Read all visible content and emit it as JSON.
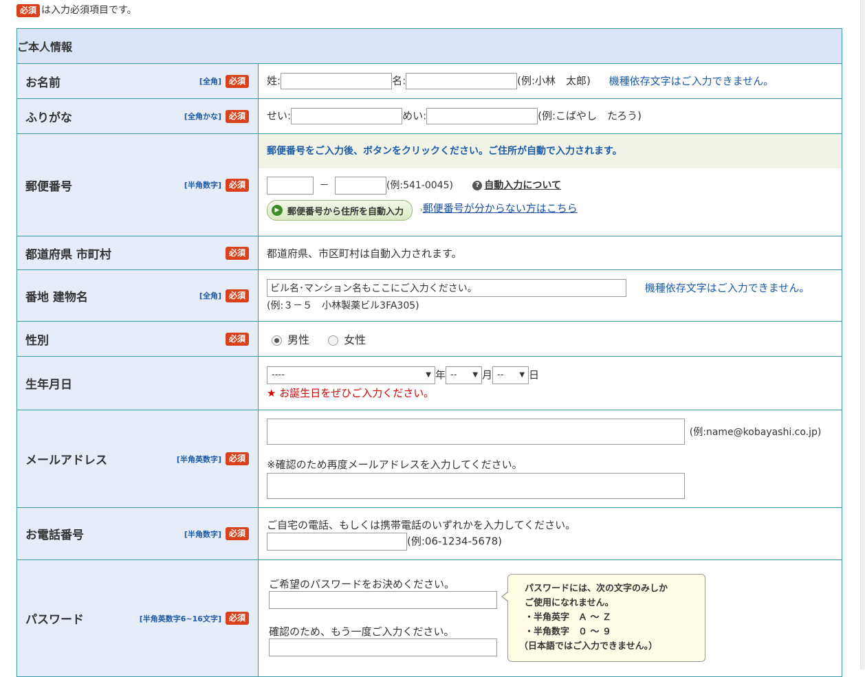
{
  "required_badge": "必須",
  "top_note": "は入力必須項目です。",
  "section_title": "ご本人情報",
  "name": {
    "label": "お名前",
    "type_tag": "[全角]",
    "sei_prefix": "姓:",
    "mei_prefix": "名:",
    "example": "(例:小林　太郎)",
    "notice": "機種依存文字はご入力できません。"
  },
  "furigana": {
    "label": "ふりがな",
    "type_tag": "[全角かな]",
    "sei_prefix": "せい:",
    "mei_prefix": "めい:",
    "example": "(例:こばやし　たろう)"
  },
  "zip": {
    "label": "郵便番号",
    "type_tag": "[半角数字]",
    "instruction": "郵便番号をご入力後、ボタンをクリックください。ご住所が自動で入力されます。",
    "dash": "－",
    "example": "(例:541-0045)",
    "help_link": "自動入力について",
    "button_label": "郵便番号から住所を自動入力",
    "unknown_link": "郵便番号が分からない方はこちら"
  },
  "prefecture": {
    "label": "都道府県 市町村",
    "text": "都道府県、市区町村は自動入力されます。"
  },
  "address": {
    "label": "番地 建物名",
    "type_tag": "[全角]",
    "value": "ビル名･マンション名もここにご入力ください。",
    "notice": "機種依存文字はご入力できません。",
    "example": "(例:３－５　小林製薬ビル3FA305)"
  },
  "gender": {
    "label": "性別",
    "options": [
      "男性",
      "女性"
    ],
    "selected": "男性"
  },
  "birthday": {
    "label": "生年月日",
    "year_value": "----",
    "year_suffix": "年",
    "month_value": "--",
    "month_suffix": "月",
    "day_value": "--",
    "day_suffix": "日",
    "star": "★",
    "note": "お誕生日をぜひご入力ください。"
  },
  "email": {
    "label": "メールアドレス",
    "type_tag": "[半角英数字]",
    "example": "(例:name@kobayashi.co.jp)",
    "confirm_note": "※確認のため再度メールアドレスを入力してください。"
  },
  "phone": {
    "label": "お電話番号",
    "type_tag": "[半角数字]",
    "note": "ご自宅の電話、もしくは携帯電話のいずれかを入力してください。",
    "example": "(例:06-1234-5678)"
  },
  "password": {
    "label": "パスワード",
    "type_tag": "[半角英数字6~16文字]",
    "prompt": "ご希望のパスワードをお決めください。",
    "confirm_prompt": "確認のため、もう一度ご入力ください。",
    "tooltip_lines": [
      "パスワードには、次の文字のみしか",
      "ご使用になれません。",
      "・半角英字　Ａ ～ Ｚ",
      "・半角数字　０ ～ ９",
      "（日本語ではご入力できません。）"
    ]
  }
}
